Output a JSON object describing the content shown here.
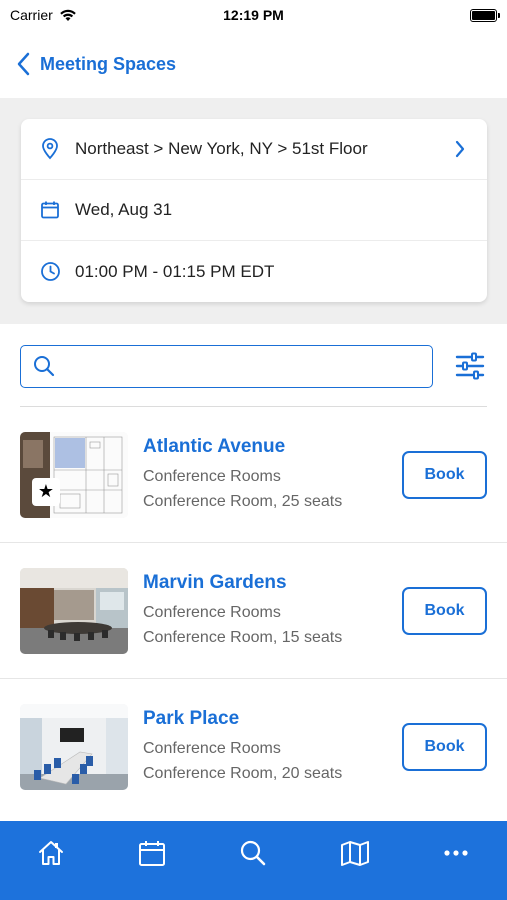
{
  "status": {
    "carrier": "Carrier",
    "time": "12:19 PM"
  },
  "header": {
    "title": "Meeting Spaces",
    "back_icon": "chevron-left-icon"
  },
  "filters": {
    "location": "Northeast > New York, NY > 51st Floor",
    "date": "Wed, Aug 31",
    "time": "01:00 PM - 01:15 PM EDT"
  },
  "search": {
    "placeholder": "",
    "value": ""
  },
  "rooms": [
    {
      "name": "Atlantic Avenue",
      "type": "Conference Rooms",
      "detail": "Conference Room, 25 seats",
      "book_label": "Book",
      "favorite": true
    },
    {
      "name": "Marvin Gardens",
      "type": "Conference Rooms",
      "detail": "Conference Room, 15 seats",
      "book_label": "Book",
      "favorite": false
    },
    {
      "name": "Park Place",
      "type": "Conference Rooms",
      "detail": "Conference Room, 20 seats",
      "book_label": "Book",
      "favorite": false
    }
  ],
  "tabs": [
    {
      "icon": "home-icon"
    },
    {
      "icon": "calendar-icon"
    },
    {
      "icon": "search-icon"
    },
    {
      "icon": "map-icon"
    },
    {
      "icon": "more-icon"
    }
  ],
  "colors": {
    "accent": "#1a6fd6",
    "tab_bar": "#1d72dc",
    "filter_background": "#efefef"
  }
}
